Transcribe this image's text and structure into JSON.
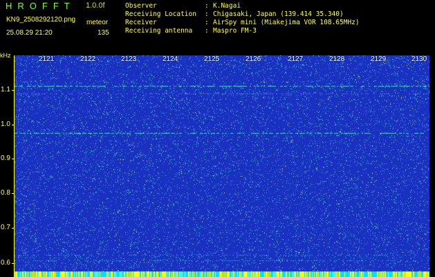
{
  "header": {
    "app_title": "HROFFT",
    "version": "1.0.0f",
    "filename": "KN9_2508292120.png",
    "meteor_label": "meteor",
    "timestamp": "25.08.29 21:20",
    "meteor_count": "135"
  },
  "info": {
    "rows": [
      {
        "label": "Observer",
        "value": "K.Nagai"
      },
      {
        "label": "Receiving Location",
        "value": "Chigasaki, Japan (139.414 35.340)"
      },
      {
        "label": "Receiver",
        "value": "AirSpy mini (Miakejima VOR 108.65MHz)"
      },
      {
        "label": "Receiving antenna",
        "value": "Maspro FM-3"
      }
    ],
    "separator": ":"
  },
  "spectrogram": {
    "unit_label": "kHz",
    "time_labels": [
      "2121",
      "2122",
      "2123",
      "2124",
      "2125",
      "2126",
      "2127",
      "2128",
      "2129",
      "2130"
    ],
    "freq_labels": [
      "1.1",
      "1.0",
      "0.9",
      "0.8",
      "0.7",
      "0.6"
    ],
    "colors": {
      "background": "#1a30c0",
      "noise_mid": "#2f8fe0",
      "noise_high": "#40e0c0",
      "noise_peak": "#e8f060",
      "axis": "#ffff44",
      "bottom_strip_cyan": "#00e0ff",
      "bottom_strip_yellow": "#ffff00"
    }
  }
}
